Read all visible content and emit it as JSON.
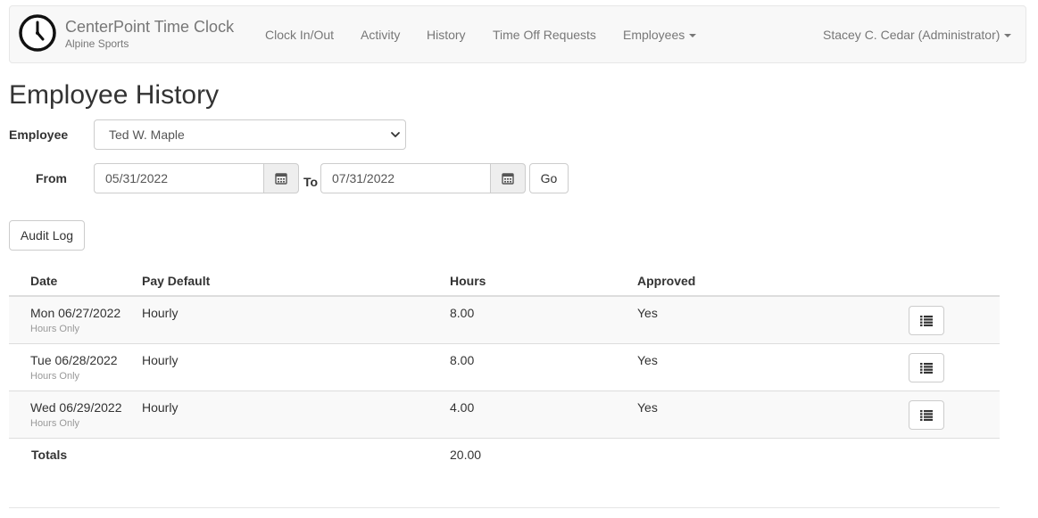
{
  "brand": {
    "title": "CenterPoint Time Clock",
    "subtitle": "Alpine Sports",
    "icon": "clock-icon"
  },
  "nav": {
    "items": [
      {
        "label": "Clock In/Out"
      },
      {
        "label": "Activity"
      },
      {
        "label": "History"
      },
      {
        "label": "Time Off Requests"
      },
      {
        "label": "Employees"
      }
    ],
    "user": "Stacey C. Cedar (Administrator)"
  },
  "page": {
    "title": "Employee History"
  },
  "filters": {
    "employee_label": "Employee",
    "employee_selected": "Ted W. Maple",
    "from_label": "From",
    "from_value": "05/31/2022",
    "to_label": "To",
    "to_value": "07/31/2022",
    "go_label": "Go",
    "calendar_icon": "calendar-icon"
  },
  "audit_log_label": "Audit Log",
  "table": {
    "headers": {
      "date": "Date",
      "pay_default": "Pay Default",
      "hours": "Hours",
      "approved": "Approved"
    },
    "rows": [
      {
        "date": "Mon 06/27/2022",
        "sub": "Hours Only",
        "pay_default": "Hourly",
        "hours": "8.00",
        "approved": "Yes"
      },
      {
        "date": "Tue 06/28/2022",
        "sub": "Hours Only",
        "pay_default": "Hourly",
        "hours": "8.00",
        "approved": "Yes"
      },
      {
        "date": "Wed 06/29/2022",
        "sub": "Hours Only",
        "pay_default": "Hourly",
        "hours": "4.00",
        "approved": "Yes"
      }
    ],
    "totals_label": "Totals",
    "totals_hours": "20.00",
    "row_action_icon": "list-icon"
  },
  "colors": {
    "navbar_bg": "#f8f8f8",
    "nav_text": "#777777",
    "text": "#333333",
    "stripe": "#f9f9f9",
    "border": "#dddddd"
  }
}
